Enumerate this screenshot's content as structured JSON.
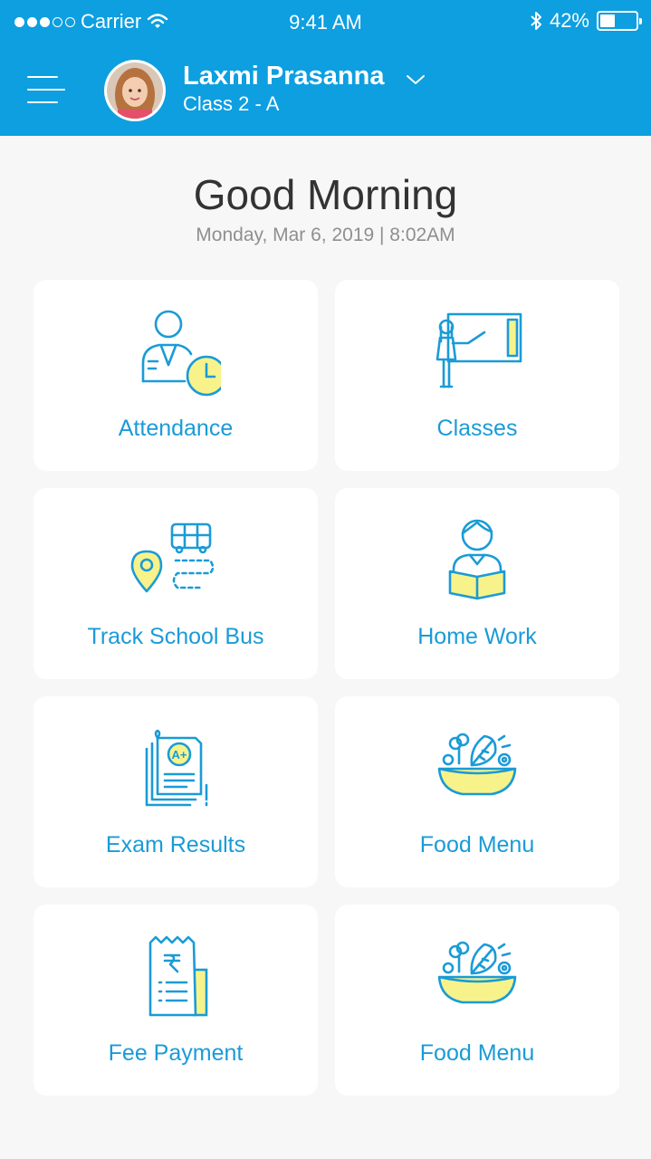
{
  "status_bar": {
    "carrier": "Carrier",
    "time": "9:41 AM",
    "battery_text": "42%",
    "battery_level": 0.42,
    "signal_bars_filled": 3,
    "signal_bars_total": 5
  },
  "header": {
    "user_name": "Laxmi Prasanna",
    "user_class": "Class 2 - A"
  },
  "greeting": {
    "title": "Good Morning",
    "datetime": "Monday, Mar 6, 2019 | 8:02AM"
  },
  "tiles": [
    {
      "label": "Attendance",
      "icon": "attendance-icon"
    },
    {
      "label": "Classes",
      "icon": "classes-icon"
    },
    {
      "label": "Track School Bus",
      "icon": "school-bus-icon"
    },
    {
      "label": "Home Work",
      "icon": "homework-icon"
    },
    {
      "label": "Exam Results",
      "icon": "exam-results-icon"
    },
    {
      "label": "Food Menu",
      "icon": "food-menu-icon"
    },
    {
      "label": "Fee Payment",
      "icon": "fee-receipt-icon"
    },
    {
      "label": "Food Menu",
      "icon": "food-menu-icon"
    }
  ],
  "colors": {
    "header_bg": "#0d9fe0",
    "accent": "#1a9bd7",
    "icon_fill": "#f7f38a",
    "page_bg": "#f7f7f7"
  }
}
